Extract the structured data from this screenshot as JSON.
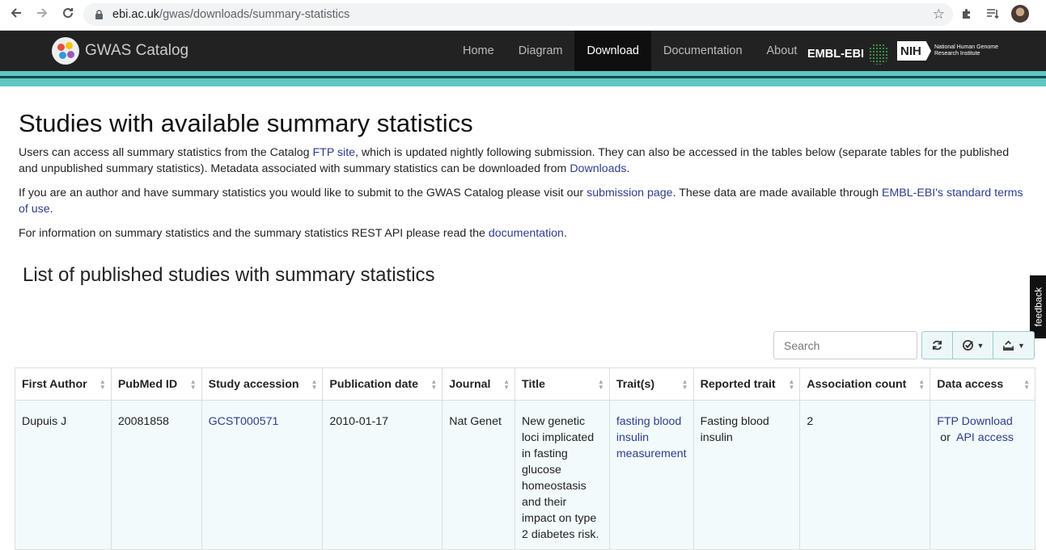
{
  "browser": {
    "url_host": "ebi.ac.uk",
    "url_path": "/gwas/downloads/summary-statistics"
  },
  "header": {
    "brand": "GWAS Catalog",
    "nav": [
      "Home",
      "Diagram",
      "Download",
      "Documentation",
      "About"
    ],
    "active_nav": "Download",
    "embl": "EMBL-EBI",
    "nih": "NIH",
    "nih_text": "National Human Genome Research Institute"
  },
  "page": {
    "title": "Studies with available summary statistics",
    "p1": {
      "a": "Users can access all summary statistics from the Catalog ",
      "link1": "FTP site",
      "b": ", which is updated nightly following submission. They can also be accessed in the tables below (separate tables for the published and unpublished summary statistics). Metadata associated with summary statistics can be downloaded from ",
      "link2": "Downloads",
      "c": "."
    },
    "p2": {
      "a": "If you are an author and have summary statistics you would like to submit to the GWAS Catalog please visit our ",
      "link1": "submission page",
      "b": ". These data are made available through ",
      "link2": "EMBL-EBI's standard terms of use",
      "c": "."
    },
    "p3": {
      "a": "For information on summary statistics and the summary statistics REST API please read the ",
      "link1": "documentation",
      "c": "."
    },
    "section_title": "List of published studies with summary statistics",
    "feedback": "feedback",
    "search_placeholder": "Search"
  },
  "table": {
    "headers": [
      "First Author",
      "PubMed ID",
      "Study accession",
      "Publication date",
      "Journal",
      "Title",
      "Trait(s)",
      "Reported trait",
      "Association count",
      "Data access"
    ],
    "rows": [
      {
        "first_author": "Dupuis J",
        "pubmed_id": "20081858",
        "study_accession": "GCST000571",
        "publication_date": "2010-01-17",
        "journal": "Nat Genet",
        "title": "New genetic loci implicated in fasting glucose homeostasis and their impact on type 2 diabetes risk.",
        "traits": "fasting blood insulin measurement",
        "reported_trait": "Fasting blood insulin",
        "association_count": "2",
        "data_access": {
          "ftp": "FTP Download",
          "or": "or",
          "api": "API access"
        }
      }
    ]
  }
}
